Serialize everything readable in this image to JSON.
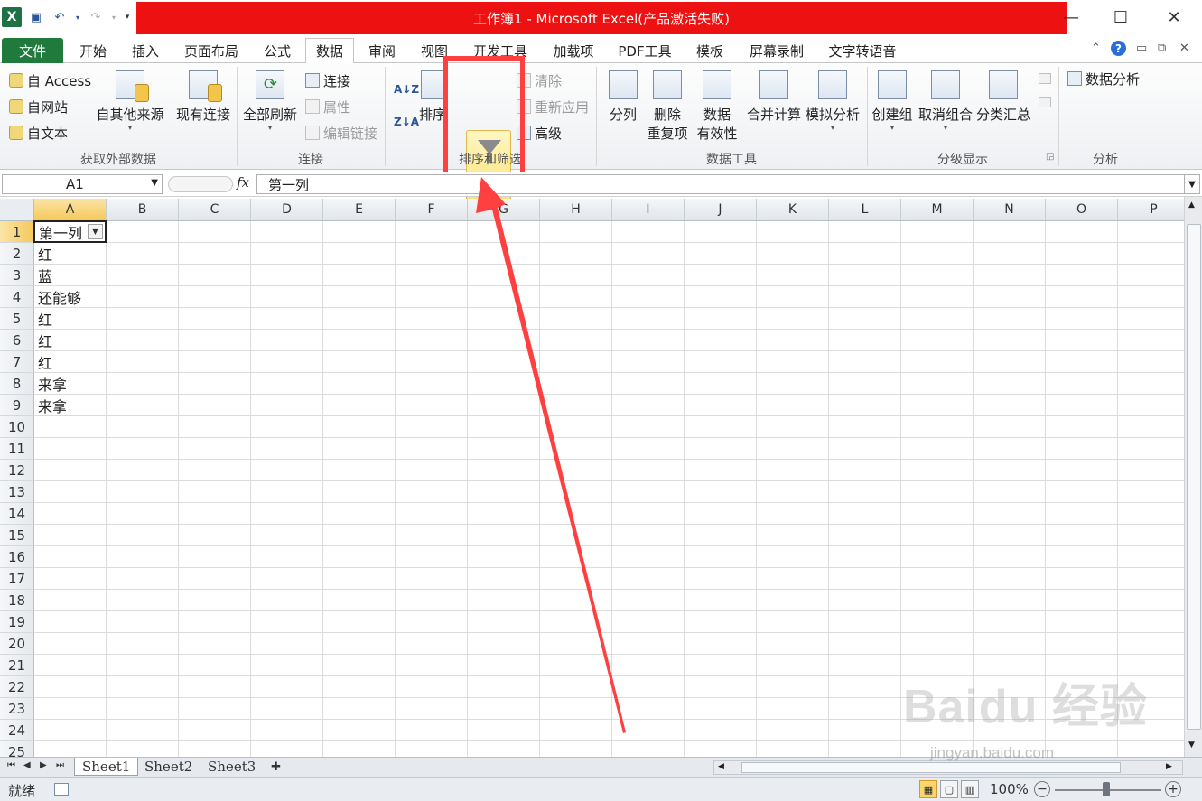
{
  "window": {
    "title": "工作簿1 - Microsoft Excel(产品激活失败)",
    "title_bg": "#ee1111"
  },
  "tabs": {
    "file": "文件",
    "items": [
      "开始",
      "插入",
      "页面布局",
      "公式",
      "数据",
      "审阅",
      "视图",
      "开发工具",
      "加载项",
      "PDF工具",
      "模板",
      "屏幕录制",
      "文字转语音"
    ],
    "active": "数据"
  },
  "ribbon": {
    "external": {
      "label": "获取外部数据",
      "access": "自 Access",
      "web": "自网站",
      "text": "自文本",
      "other_sources": "自其他来源",
      "existing": "现有连接"
    },
    "connections": {
      "label": "连接",
      "refresh_all": "全部刷新",
      "connections": "连接",
      "properties": "属性",
      "edit_links": "编辑链接"
    },
    "sort_filter": {
      "label": "排序和筛选",
      "sort": "排序",
      "filter": "筛选",
      "clear": "清除",
      "reapply": "重新应用",
      "advanced": "高级"
    },
    "data_tools": {
      "label": "数据工具",
      "text_to_columns": "分列",
      "remove_dup_1": "删除",
      "remove_dup_2": "重复项",
      "validation_1": "数据",
      "validation_2": "有效性",
      "consolidate": "合并计算",
      "what_if": "模拟分析"
    },
    "outline": {
      "label": "分级显示",
      "group": "创建组",
      "ungroup": "取消组合",
      "subtotal": "分类汇总"
    },
    "analysis": {
      "label": "分析",
      "data_analysis": "数据分析"
    }
  },
  "formula_bar": {
    "name_box": "A1",
    "fx": "fx",
    "value": "第一列"
  },
  "columns": [
    "A",
    "B",
    "C",
    "D",
    "E",
    "F",
    "G",
    "H",
    "I",
    "J",
    "K",
    "L",
    "M",
    "N",
    "O",
    "P"
  ],
  "rows": [
    "1",
    "2",
    "3",
    "4",
    "5",
    "6",
    "7",
    "8",
    "9",
    "10",
    "11",
    "12",
    "13",
    "14",
    "15",
    "16",
    "17",
    "18",
    "19",
    "20",
    "21",
    "22",
    "23",
    "24",
    "25"
  ],
  "cells_A": [
    "第一列",
    "红",
    "蓝",
    "还能够",
    "红",
    "红",
    "红",
    "来拿",
    "来拿"
  ],
  "sheets": [
    "Sheet1",
    "Sheet2",
    "Sheet3"
  ],
  "status": {
    "ready": "就绪",
    "zoom": "100%"
  },
  "watermark": {
    "brand": "Baidu 经验",
    "url": "jingyan.baidu.com"
  },
  "annotation_color": "#ff4040"
}
